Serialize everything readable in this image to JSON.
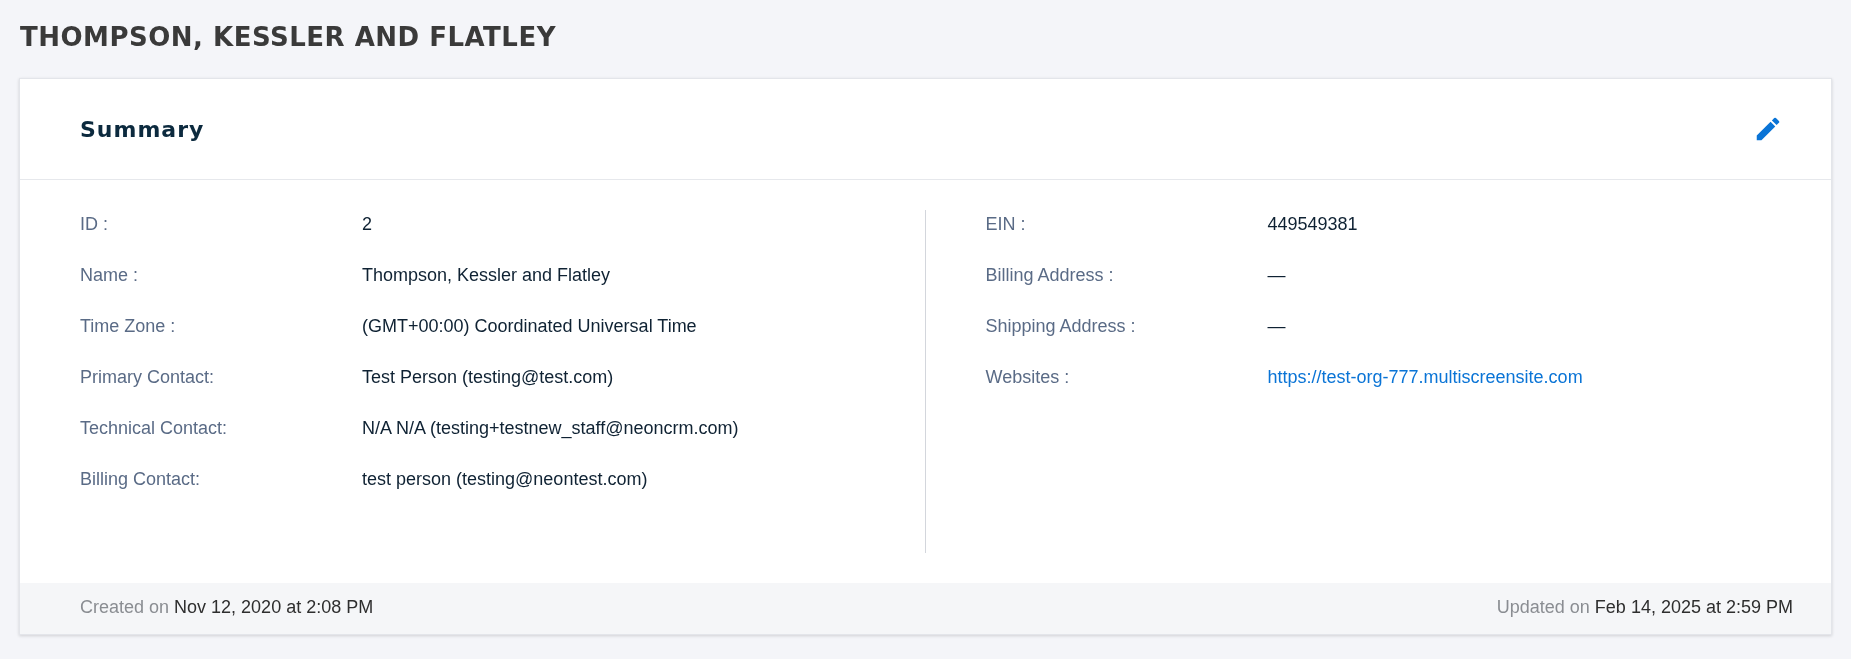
{
  "page_title": "THOMPSON, KESSLER AND FLATLEY",
  "summary": {
    "title": "Summary",
    "left_fields": [
      {
        "label": "ID :",
        "value": "2",
        "kind": "text"
      },
      {
        "label": "Name :",
        "value": "Thompson, Kessler and Flatley",
        "kind": "text"
      },
      {
        "label": "Time Zone :",
        "value": "(GMT+00:00) Coordinated Universal Time",
        "kind": "text"
      },
      {
        "label": "Primary Contact:",
        "value": "Test Person (testing@test.com)",
        "kind": "text"
      },
      {
        "label": "Technical Contact:",
        "value": "N/A N/A (testing+testnew_staff@neoncrm.com)",
        "kind": "text"
      },
      {
        "label": "Billing Contact:",
        "value": "test person (testing@neontest.com)",
        "kind": "text"
      }
    ],
    "right_fields": [
      {
        "label": "EIN :",
        "value": "449549381",
        "kind": "text"
      },
      {
        "label": "Billing Address :",
        "value": "—",
        "kind": "text"
      },
      {
        "label": "Shipping Address :",
        "value": "—",
        "kind": "text"
      },
      {
        "label": "Websites :",
        "value": "https://test-org-777.multiscreensite.com",
        "kind": "link"
      }
    ],
    "footer": {
      "created_label": "Created on",
      "created_value": "Nov 12, 2020 at 2:08 PM",
      "updated_label": "Updated on",
      "updated_value": "Feb 14, 2025 at 2:59 PM"
    }
  }
}
